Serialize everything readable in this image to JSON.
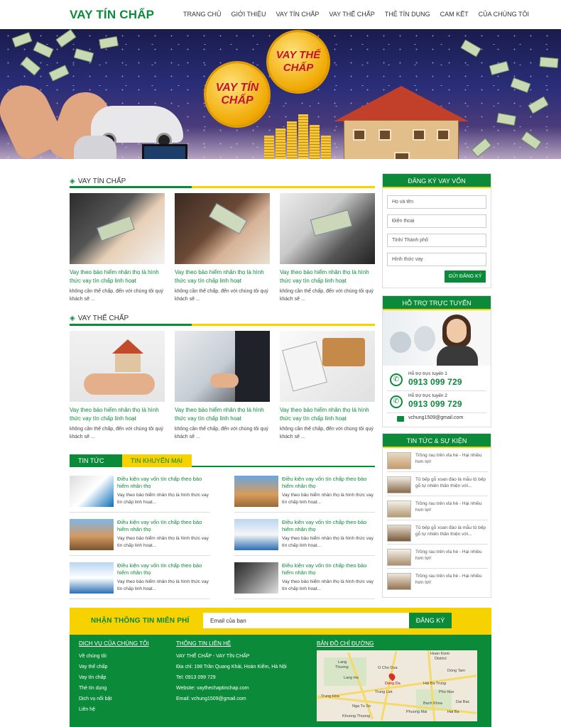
{
  "logo": "VAY TÍN CHẤP",
  "nav": [
    "TRANG CHỦ",
    "GIỚI THIỆU",
    "VAY TÍN CHẤP",
    "VAY THẾ CHẤP",
    "THẺ TÍN DỤNG",
    "CAM KẾT",
    "CỦA CHÚNG TÔI"
  ],
  "banner": {
    "coin1": "VAY TÍN CHẤP",
    "coin2": "VAY THẾ CHẤP"
  },
  "section1": {
    "title": "VAY TÍN CHẤP"
  },
  "section2": {
    "title": "VAY THẾ CHẤP"
  },
  "card": {
    "title": "Vay theo bảo hiểm nhân thọ là hình thức vay tín chấp linh hoạt",
    "desc": "không cần thế chấp, đến với chúng tôi quý khách sẽ ..."
  },
  "tabs": {
    "active": "TIN TỨC",
    "other": "TIN KHUYẾN MẠI"
  },
  "news_item": {
    "title": "Điều kiện vay vốn tín chấp theo bảo hiểm nhân thọ",
    "desc": "Vay theo bảo hiểm nhân thọ là hình thức vay tín chấp linh hoạt..."
  },
  "register": {
    "title": "ĐĂNG KÝ VAY VỐN",
    "fields": [
      "Họ và tên",
      "Điện thoại",
      "Tỉnh/ Thành phố",
      "Hình thức vay"
    ],
    "button": "GỬI ĐĂNG KÝ"
  },
  "support": {
    "title": "HỖ TRỢ TRỰC TUYẾN",
    "lines": [
      {
        "label": "Hỗ trợ trực tuyến 1",
        "phone": "0913 099 729"
      },
      {
        "label": "Hỗ trợ trực tuyến 2",
        "phone": "0913 099 729"
      }
    ],
    "email": "vchung1509@gmail.com"
  },
  "sidenews": {
    "title": "TIN TỨC & SỰ KIỆN",
    "items": [
      "Trồng rau trên vỉa hè - Hại nhiều hơn lợi!",
      "Tủ bếp gỗ xoan đào là mẫu tủ bếp gỗ tự nhiên thân thiện với...",
      "Trồng rau trên vỉa hè - Hại nhiều hơn lợi!",
      "Tủ bếp gỗ xoan đào là mẫu tủ bếp gỗ tự nhiên thân thiện với...",
      "Trồng rau trên vỉa hè - Hại nhiều hơn lợi!",
      "Trồng rau trên vỉa hè - Hại nhiều hơn lợi!"
    ]
  },
  "newsletter": {
    "label": "NHẬN THÔNG TIN MIỄN PHÍ",
    "placeholder": "Email của bạn",
    "button": "ĐĂNG KÝ"
  },
  "footer": {
    "col1": {
      "title": "DỊCH VỤ CỦA CHÚNG TÔI",
      "items": [
        "Về chúng tôi",
        "Vay thế chấp",
        "Vay tín chấp",
        "Thẻ tín dụng",
        "Dịch vụ nổi bật",
        "Liên hệ"
      ]
    },
    "col2": {
      "title": "THÔNG TIN LIÊN HỆ",
      "items": [
        "VAY THẾ CHẤP - VAY TÍN CHẤP",
        "Địa chỉ: 198 Trần Quang Khải, Hoàn Kiếm, Hà Nội",
        "Tel: 0913 099 729",
        "Website: vaythechaptinchap.com",
        "Email: vchung1509@gmail.com"
      ]
    },
    "col3": {
      "title": "BẢN ĐỒ CHỈ ĐƯỜNG"
    },
    "map_labels": [
      "Hoan Kiem",
      "District",
      "Lang",
      "Thuong",
      "O Cho Dua",
      "Dong Da",
      "Lang Ha",
      "Trung Liet",
      "Hai Ba Trung",
      "Pho Hue",
      "Bach Khoa",
      "Phuong Mai",
      "Trung Hoa",
      "Nga Tu So",
      "Dai Bac",
      "Hai Ba",
      "Dong Tam",
      "Khuong Thuong"
    ]
  },
  "colors": {
    "green": "#0b8a3a",
    "yellow": "#f5d200"
  }
}
